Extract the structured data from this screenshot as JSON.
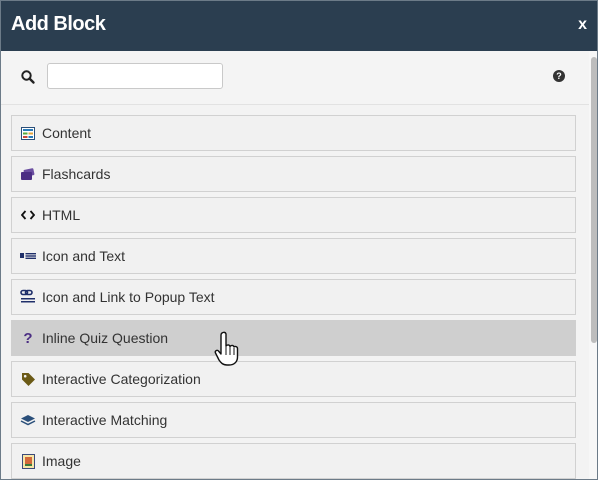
{
  "dialog": {
    "title": "Add Block",
    "close_label": "x"
  },
  "search": {
    "value": "",
    "placeholder": "",
    "help_label": "?"
  },
  "blocks": [
    {
      "label": "Content",
      "icon": "content-icon"
    },
    {
      "label": "Flashcards",
      "icon": "flashcards-icon"
    },
    {
      "label": "HTML",
      "icon": "code-icon"
    },
    {
      "label": "Icon and Text",
      "icon": "icon-text-icon"
    },
    {
      "label": "Icon and Link to Popup Text",
      "icon": "link-popup-icon"
    },
    {
      "label": "Inline Quiz Question",
      "icon": "question-icon",
      "state": "hover"
    },
    {
      "label": "Interactive Categorization",
      "icon": "tag-icon"
    },
    {
      "label": "Interactive Matching",
      "icon": "layers-icon"
    },
    {
      "label": "Image",
      "icon": "image-icon"
    }
  ],
  "colors": {
    "titlebar": "#2b3e50",
    "hover_row": "#cfcfcf",
    "accent_purple": "#4b2e83"
  }
}
